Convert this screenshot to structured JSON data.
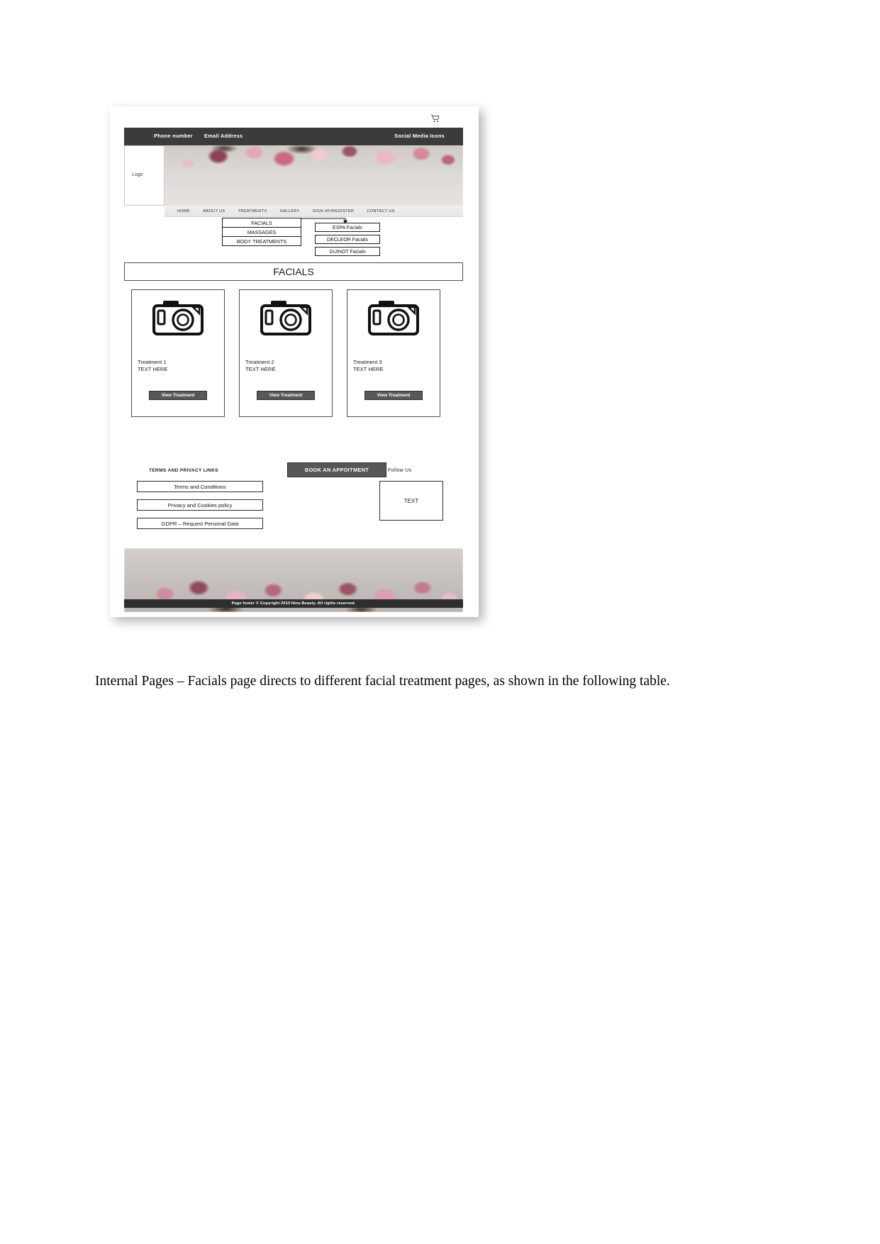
{
  "document": {
    "caption": "Internal Pages – Facials page directs to different facial treatment pages, as shown in the following table."
  },
  "wireframe": {
    "topbar": {
      "phone_label": "Phone number",
      "email_label": "Email Address",
      "social_label": "Social Media Icons"
    },
    "logo": {
      "label": "Logo"
    },
    "nav": {
      "items": [
        "HOME",
        "ABOUT US",
        "TREATMENTS",
        "GALLERY",
        "SIGN UP/REGISTER",
        "CONTACT US"
      ],
      "cart_icon": "shopping-cart-icon"
    },
    "dropdown_primary": {
      "items": [
        "FACIALS",
        "MASSAGES",
        "BODY TREATMENTS"
      ]
    },
    "dropdown_sub": {
      "items": [
        "ESPA Facials",
        "DECLEOR Facials",
        "GUINOT Facials"
      ]
    },
    "page_title": "FACIALS",
    "cards": [
      {
        "image_placeholder": "camera-icon",
        "title": "Treatment 1",
        "subtitle": "TEXT HERE",
        "button_label": "View Treatment"
      },
      {
        "image_placeholder": "camera-icon",
        "title": "Treatment 2",
        "subtitle": "TEXT HERE",
        "button_label": "View Treatment"
      },
      {
        "image_placeholder": "camera-icon",
        "title": "Treatment 3",
        "subtitle": "TEXT HERE",
        "button_label": "View Treatment"
      }
    ],
    "footer": {
      "terms_heading": "TERMS AND PRIVACY LINKS",
      "links": [
        "Terms and Conditions",
        "Privacy and Cookies policy",
        "GDPR – Request Personal Data"
      ],
      "book_button": "BOOK AN APPOITMENT",
      "follow_heading": "Follow Us",
      "social_box_text": "TEXT",
      "copyright": "Page footer  © Copyright 2019 Nina  Beauty. All rights reserved."
    },
    "colors": {
      "topbar_bg": "#3b3b3b",
      "button_bg": "#575757",
      "outline": "#1a1a1a",
      "footer_bg": "#2e2e2e"
    }
  }
}
